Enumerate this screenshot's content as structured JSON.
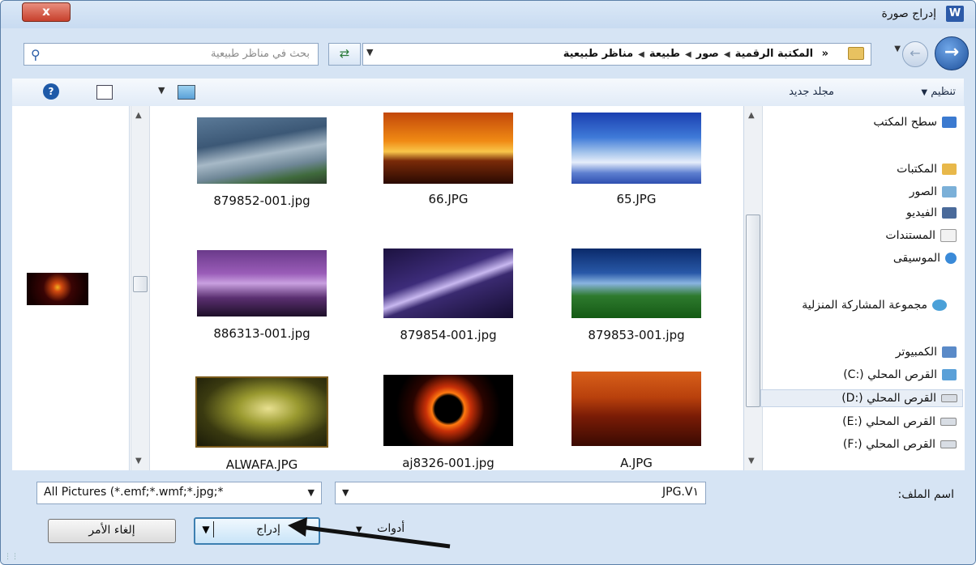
{
  "window": {
    "title": "إدراج صورة",
    "close": "x",
    "app_icon_letter": "W"
  },
  "search": {
    "placeholder": "بحث في مناظر طبيعية"
  },
  "breadcrumb": {
    "overflow": "«",
    "parts": [
      "المكتبة الرقمية",
      "صور",
      "طبيعة",
      "مناظر طبيعية"
    ]
  },
  "toolbar": {
    "organize": "تنظيم",
    "new_folder": "مجلد جديد"
  },
  "files": [
    {
      "name": "879852-001.jpg",
      "thumb": "storm-sea"
    },
    {
      "name": "66.JPG",
      "thumb": "sunset-palms"
    },
    {
      "name": "65.JPG",
      "thumb": "snow-forest"
    },
    {
      "name": "886313-001.jpg",
      "thumb": "lightning-city"
    },
    {
      "name": "879854-001.jpg",
      "thumb": "lightning-purple"
    },
    {
      "name": "879853-001.jpg",
      "thumb": "storm-field"
    },
    {
      "name": "ALWAFA.JPG",
      "thumb": "dark-tree"
    },
    {
      "name": "aj8326-001.jpg",
      "thumb": "eclipse"
    },
    {
      "name": "A.JPG",
      "thumb": "red-palms"
    }
  ],
  "nav": {
    "desktop": "سطح المكتب",
    "libraries": "المكتبات",
    "pictures": "الصور",
    "videos": "الفيديو",
    "documents": "المستندات",
    "music": "الموسيقى",
    "homegroup": "مجموعة المشاركة المنزلية",
    "computer": "الكمبيوتر",
    "drives": [
      "القرص المحلي (:C)",
      "القرص المحلي (:D)",
      "القرص المحلي (:E)",
      "القرص المحلي (:F)"
    ]
  },
  "bottom": {
    "filename_label": "اسم الملف:",
    "filename_value": "JPG.V١",
    "filetype": "All Pictures (*.emf;*.wmf;*.jpg;*",
    "tools": "أدوات",
    "insert": "إدراج",
    "cancel": "إلغاء الأمر"
  }
}
